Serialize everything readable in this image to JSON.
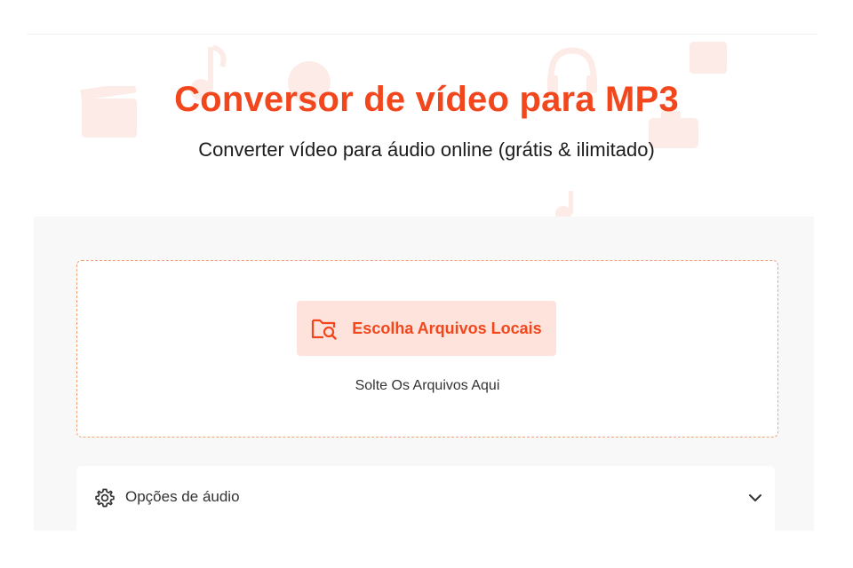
{
  "header": {
    "title": "Conversor de vídeo para MP3",
    "subtitle": "Converter vídeo para áudio online (grátis & ilimitado)"
  },
  "upload": {
    "button_label": "Escolha Arquivos Locais",
    "button_icon": "folder-search-icon",
    "drop_hint": "Solte Os Arquivos Aqui"
  },
  "options": {
    "label": "Opções de áudio",
    "icon": "gear-icon",
    "toggle_icon": "chevron-down-icon"
  },
  "colors": {
    "accent": "#f2461d",
    "button_bg": "#fde3dc",
    "dropzone_border": "#f3a27e",
    "panel_bg": "#f8f8f8"
  }
}
